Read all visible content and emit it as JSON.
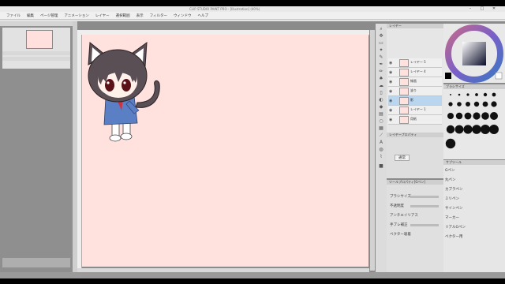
{
  "window": {
    "title": "CLIP STUDIO PAINT PRO - [Illustration] (40%)",
    "controls": [
      "–",
      "□",
      "✕"
    ]
  },
  "menu": [
    "ファイル",
    "編集",
    "ページ管理",
    "アニメーション",
    "レイヤー",
    "選択範囲",
    "表示",
    "フィルター",
    "ウィンドウ",
    "ヘルプ"
  ],
  "colors": {
    "canvas": "#ffe1de",
    "selected_layer": "#b9d6ee",
    "accent": "#3a78c2"
  },
  "layers": {
    "header": "レイヤー",
    "items": [
      {
        "name": "レイヤー 5",
        "selected": false
      },
      {
        "name": "レイヤー 4",
        "selected": false
      },
      {
        "name": "線画",
        "selected": false
      },
      {
        "name": "塗り",
        "selected": false
      },
      {
        "name": "影",
        "selected": true
      },
      {
        "name": "レイヤー 1",
        "selected": false
      },
      {
        "name": "用紙",
        "selected": false
      }
    ]
  },
  "layer_props": {
    "header": "レイヤープロパティ",
    "blend_mode": "通常"
  },
  "tool_props": {
    "header": "ツールプロパティ[Gペン]",
    "rows": [
      "ブラシサイズ",
      "不透明度",
      "アンチエイリアス",
      "手ブレ補正",
      "ベクター吸着"
    ]
  },
  "subtool": {
    "header": "サブツール",
    "items": [
      "Gペン",
      "丸ペン",
      "カブラペン",
      "ミリペン",
      "サインペン",
      "マーカー",
      "リアルGペン",
      "ベクター用"
    ]
  },
  "brush_size_header": "ブラシサイズ"
}
